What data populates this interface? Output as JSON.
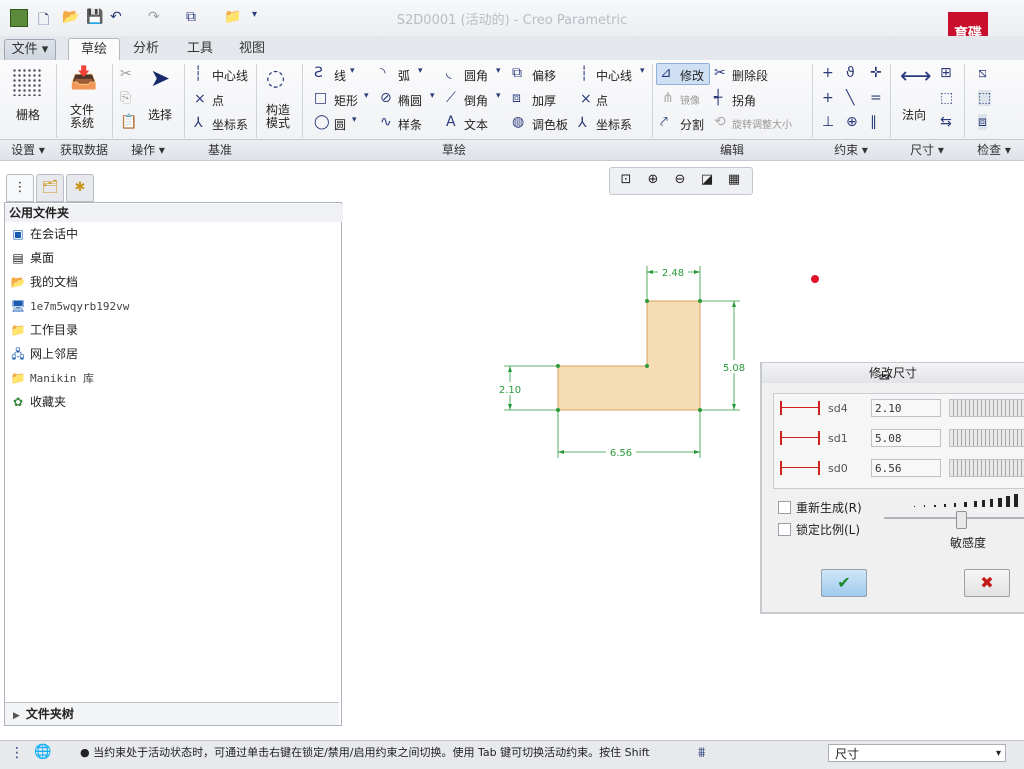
{
  "window": {
    "title": "S2D0001 (活动的) - Creo Parametric",
    "logo_text": [
      "育碟",
      "软件"
    ]
  },
  "menu_tabs": [
    {
      "label": "文件 ▾"
    },
    {
      "label": "草绘"
    },
    {
      "label": "分析"
    },
    {
      "label": "工具"
    },
    {
      "label": "视图"
    }
  ],
  "ribbon": {
    "grid": "栅格",
    "file_system": "文件\n系统",
    "select": "选择",
    "centerline": "中心线",
    "point": "点",
    "coord_sys": "坐标系",
    "construct_mode": "构造\n模式",
    "line": "线",
    "rectangle": "矩形",
    "circle": "圆",
    "arc": "弧",
    "ellipse": "椭圆",
    "spline": "样条",
    "fillet": "圆角",
    "chamfer": "倒角",
    "text": "文本",
    "offset": "偏移",
    "thicken": "加厚",
    "palette": "调色板",
    "centerline2": "中心线",
    "point2": "点",
    "coord_sys2": "坐标系",
    "modify": "修改",
    "mirror": "镜像",
    "divide": "分割",
    "delete_segment": "删除段",
    "corner": "拐角",
    "rotate_resize": "旋转调整大小",
    "normal": "法向",
    "groups": {
      "setup": "设置 ▾",
      "get_data": "获取数据",
      "operations": "操作 ▾",
      "datum": "基准",
      "sketching": "草绘",
      "editing": "编辑",
      "constrain": "约束 ▾",
      "dimension": "尺寸 ▾",
      "inspect": "检查 ▾"
    }
  },
  "folder_panel": {
    "header": "公用文件夹",
    "items": [
      {
        "label": "在会话中",
        "icon": "monitor-icon"
      },
      {
        "label": "桌面",
        "icon": "desktop-icon"
      },
      {
        "label": "我的文档",
        "icon": "folder-open-icon"
      },
      {
        "label": "1e7m5wqyrb192vw",
        "icon": "computer-icon"
      },
      {
        "label": "工作目录",
        "icon": "folder-star-icon"
      },
      {
        "label": "网上邻居",
        "icon": "network-icon"
      },
      {
        "label": "Manikin 库",
        "icon": "folder-icon"
      },
      {
        "label": "收藏夹",
        "icon": "favorites-icon"
      }
    ],
    "tree_label": "文件夹树"
  },
  "sketch": {
    "dims": {
      "top": "2.48",
      "right": "5.08",
      "left": "2.10",
      "bottom": "6.56"
    }
  },
  "dialog": {
    "title": "修改尺寸",
    "rows": [
      {
        "name": "sd4",
        "value": "2.10"
      },
      {
        "name": "sd1",
        "value": "5.08"
      },
      {
        "name": "sd0",
        "value": "6.56"
      }
    ],
    "regenerate": "重新生成(R)",
    "lock_scale": "锁定比例(L)",
    "sensitivity": "敏感度",
    "regenerate_checked": false,
    "lock_scale_checked": false,
    "sensitivity_level": 0.55
  },
  "status": {
    "message": "● 当约束处于活动状态时，可通过单击右键在锁定/禁用/启用约束之间切换。使用 Tab 键可切换活动约束。按住 Shift",
    "filter": "尺寸"
  },
  "colors": {
    "sketch_fill": "#f4dcb4",
    "sketch_edge": "#d9a060",
    "dim_green": "#2a9a3a",
    "accent_blue": "#2a3a7a"
  }
}
